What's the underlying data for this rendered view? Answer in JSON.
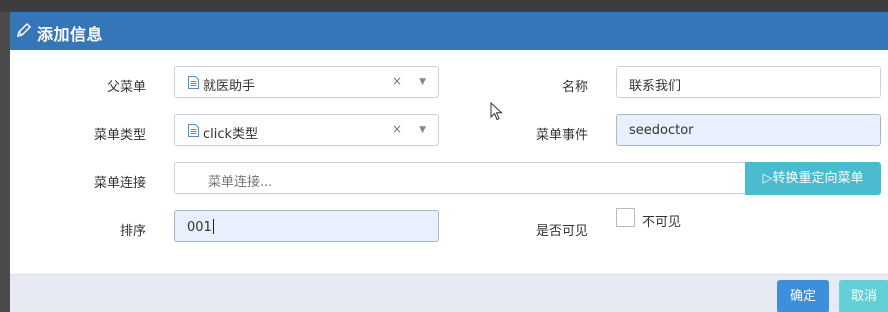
{
  "dialog": {
    "title": "添加信息",
    "title_icon": "pencil-icon"
  },
  "form": {
    "parent_menu": {
      "label": "父菜单",
      "value": "就医助手",
      "clear": "×",
      "icon": "document-icon"
    },
    "name": {
      "label": "名称",
      "value": "联系我们"
    },
    "menu_type": {
      "label": "菜单类型",
      "value": "click类型",
      "clear": "×",
      "icon": "document-icon"
    },
    "menu_event": {
      "label": "菜单事件",
      "value": "seedoctor"
    },
    "menu_link": {
      "label": "菜单连接",
      "placeholder": "菜单连接...",
      "button": "▷转换重定向菜单"
    },
    "sort": {
      "label": "排序",
      "value": "001"
    },
    "visible": {
      "label": "是否可见",
      "checkbox_label": "不可见",
      "checked": false
    }
  },
  "footer": {
    "confirm": "确定",
    "cancel": "取消"
  },
  "colors": {
    "titlebar": "#3576b8",
    "confirm": "#3d8edb",
    "cancel": "#63cfd6",
    "redirect": "#4bbcd0",
    "filled_input": "#e8f0fe"
  }
}
